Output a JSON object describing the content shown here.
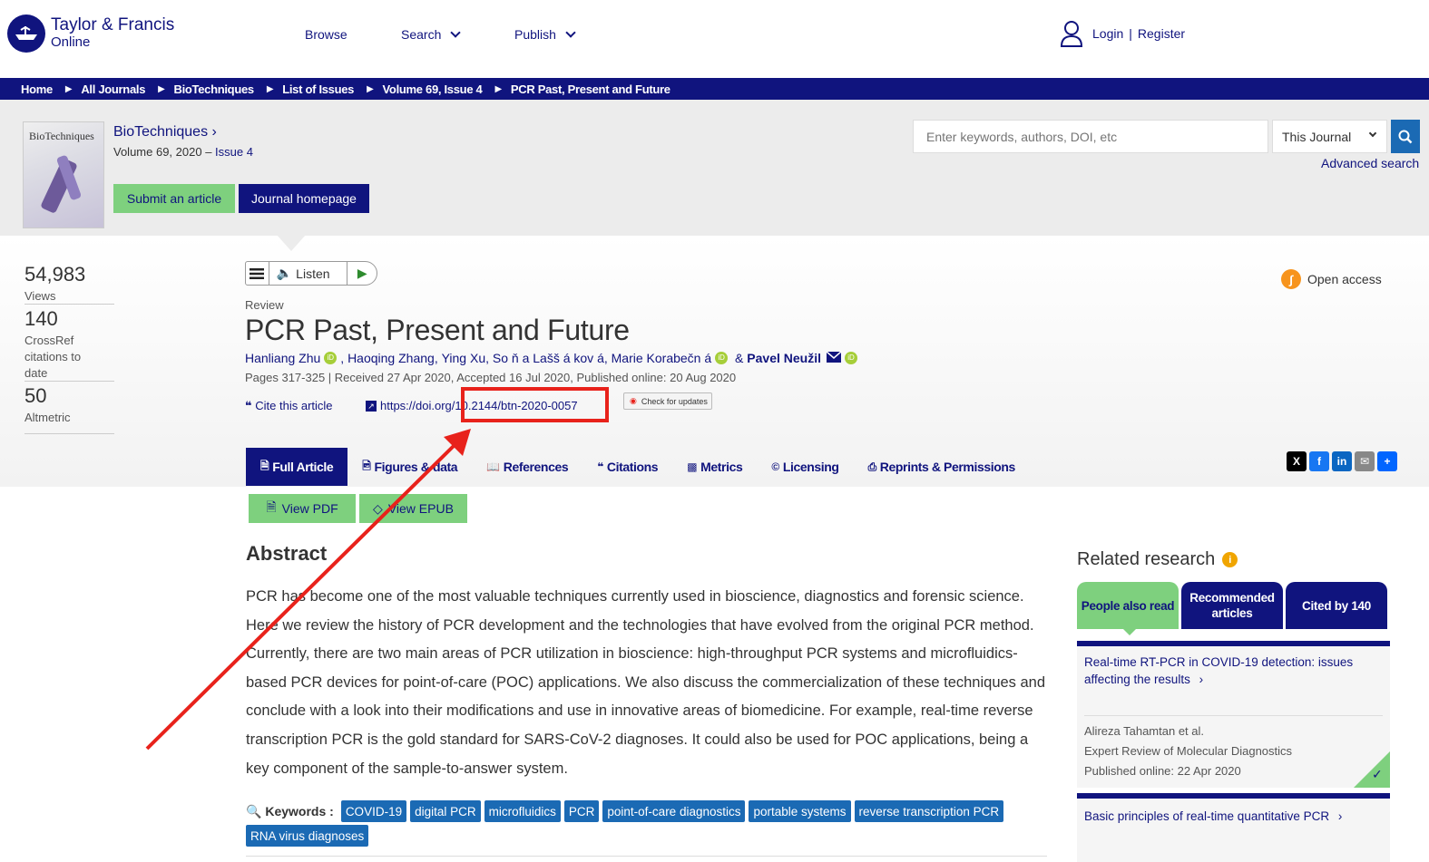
{
  "header": {
    "logo_line1": "Taylor & Francis",
    "logo_line2": "Online",
    "nav": [
      "Browse",
      "Search",
      "Publish"
    ],
    "login": "Login",
    "sep": "|",
    "register": "Register"
  },
  "breadcrumb": [
    "Home",
    "All Journals",
    "BioTechniques",
    "List of Issues",
    "Volume 69, Issue 4",
    "PCR Past, Present and Future"
  ],
  "journal": {
    "cover_title": "BioTechniques",
    "name": "BioTechniques",
    "volume": "Volume 69, 2020 – ",
    "issue": "Issue 4",
    "submit_label": "Submit an article",
    "homepage_label": "Journal homepage"
  },
  "search": {
    "placeholder": "Enter keywords, authors, DOI, etc",
    "scope": "This Journal",
    "advanced": "Advanced search"
  },
  "metrics": [
    {
      "value": "54,983",
      "label": "Views"
    },
    {
      "value": "140",
      "label": "CrossRef citations to date"
    },
    {
      "value": "50",
      "label": "Altmetric"
    }
  ],
  "listen": {
    "label": "Listen"
  },
  "article": {
    "type": "Review",
    "title": "PCR Past, Present and Future",
    "authors": [
      "Hanliang Zhu",
      "Haoqing Zhang",
      "Ying Xu",
      "So ň a Lašš á kov á",
      "Marie Korabečn á",
      "Pavel Neužil"
    ],
    "pages": "Pages 317-325 | Received 27 Apr 2020, Accepted 16 Jul 2020, Published online: 20 Aug 2020",
    "cite": "Cite this article",
    "doi_prefix": "https://doi.org/",
    "doi": "10.2144/btn-2020-0057",
    "check_updates": "Check for updates",
    "open_access": "Open access"
  },
  "tabs": [
    "Full Article",
    "Figures & data",
    "References",
    "Citations",
    "Metrics",
    "Licensing",
    "Reprints & Permissions"
  ],
  "downloads": {
    "pdf": "View PDF",
    "epub": "View EPUB"
  },
  "abstract": {
    "heading": "Abstract",
    "text": "PCR has become one of the most valuable techniques currently used in bioscience, diagnostics and forensic science. Here we review the history of PCR development and the technologies that have evolved from the original PCR method. Currently, there are two main areas of PCR utilization in bioscience: high-throughput PCR systems and microfluidics-based PCR devices for point-of-care (POC) applications. We also discuss the commercialization of these techniques and conclude with a look into their modifications and use in innovative areas of biomedicine. For example, real-time reverse transcription PCR is the gold standard for SARS-CoV-2 diagnoses. It could also be used for POC applications, being a key component of the sample-to-answer system."
  },
  "keywords": {
    "label": "Keywords",
    "items": [
      "COVID-19",
      "digital PCR",
      "microfluidics",
      "PCR",
      "point-of-care diagnostics",
      "portable systems",
      "reverse transcription PCR",
      "RNA virus diagnoses"
    ]
  },
  "related": {
    "title": "Related research",
    "tabs": [
      "People also read",
      "Recommended articles",
      "Cited by 140"
    ],
    "items": [
      {
        "title": "Real-time RT-PCR in COVID-19 detection: issues affecting the results",
        "authors": "Alireza Tahamtan et al.",
        "journal": "Expert Review of Molecular Diagnostics",
        "published": "Published online: 22 Apr 2020"
      },
      {
        "title": "Basic principles of real-time quantitative PCR"
      }
    ]
  },
  "colors": {
    "brand": "#10147e",
    "accent_green": "#7ed07e",
    "link_blue": "#1b6ab4",
    "annotation_red": "#e8221b"
  }
}
